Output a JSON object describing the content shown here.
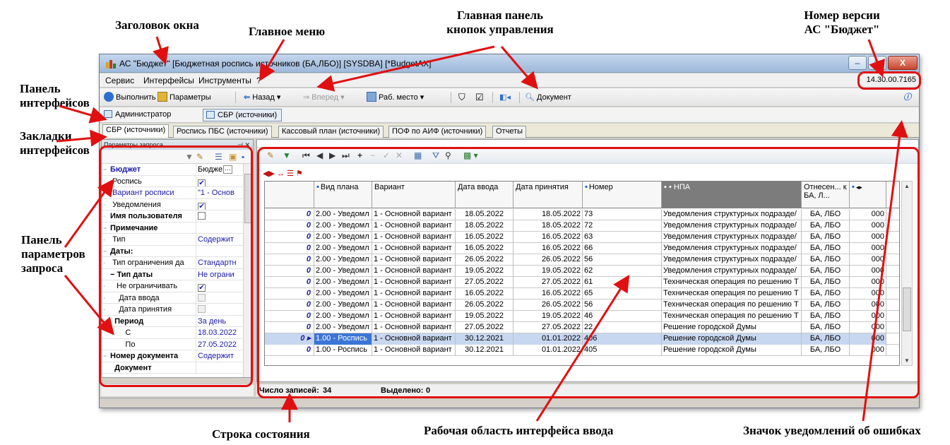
{
  "window": {
    "title": "АС \"Бюджет\" [Бюджетная роспись источников (БА,ЛБО)] [SYSDBA] [*BudgetAX]",
    "controls": [
      "–",
      "□",
      "X"
    ]
  },
  "menu": {
    "items": [
      "Сервис",
      "Интерфейсы",
      "Инструменты",
      "?"
    ],
    "version": "14.30.00.7165"
  },
  "toolbar": {
    "run": "Выполнить",
    "params": "Параметры",
    "back": "Назад",
    "forward": "Вперед",
    "workplace": "Раб. место",
    "document": "Документ"
  },
  "interfaces": {
    "admin": "Администратор",
    "sbr": "СБР (источники)"
  },
  "tabs": [
    "СБР (источники)",
    "Роспись ПБС (источники)",
    "Кассовый план (источники)",
    "ПОФ по АИФ (источники)",
    "Отчеты"
  ],
  "params": {
    "header": "Параметры запроса",
    "rows": [
      {
        "label": "Бюджет",
        "value": "Бюдже"
      },
      {
        "label": "Роспись",
        "value": ""
      },
      {
        "label": "Вариант росписи",
        "value": "\"1 - Основ"
      },
      {
        "label": "Уведомления",
        "value": ""
      },
      {
        "label": "Имя пользователя",
        "value": ""
      },
      {
        "label": "Примечание",
        "value": ""
      },
      {
        "label": "Тип",
        "value": "Содержит"
      },
      {
        "label": "Даты:",
        "value": ""
      },
      {
        "label": "Тип ограничения да",
        "value": "Стандартн"
      },
      {
        "label": "Тип даты",
        "value": "Не ограни"
      },
      {
        "label": "Не ограничивать",
        "value": ""
      },
      {
        "label": "Дата ввода",
        "value": ""
      },
      {
        "label": "Дата принятия",
        "value": ""
      },
      {
        "label": "Период",
        "value": "За день"
      },
      {
        "label": "С",
        "value": "18.03.2022"
      },
      {
        "label": "По",
        "value": "27.05.2022"
      },
      {
        "label": "Номер документа",
        "value": "Содержит"
      },
      {
        "label": "Документ",
        "value": ""
      }
    ]
  },
  "grid": {
    "columns": [
      "Вид плана",
      "Вариант",
      "Дата ввода",
      "Дата принятия",
      "Номер",
      "НПА",
      "Отнесен... к БА, Л...",
      ""
    ],
    "rows": [
      [
        "2.00 - Уведомл",
        "1 - Основной вариант",
        "18.05.2022",
        "18.05.2022",
        "73",
        "Уведомления структурных подразде/",
        "БА, ЛБО",
        "000"
      ],
      [
        "2.00 - Уведомл",
        "1 - Основной вариант",
        "18.05.2022",
        "18.05.2022",
        "72",
        "Уведомления структурных подразде/",
        "БА, ЛБО",
        "000"
      ],
      [
        "2.00 - Уведомл",
        "1 - Основной вариант",
        "16.05.2022",
        "16.05.2022",
        "63",
        "Уведомления структурных подразде/",
        "БА, ЛБО",
        "000"
      ],
      [
        "2.00 - Уведомл",
        "1 - Основной вариант",
        "16.05.2022",
        "16.05.2022",
        "66",
        "Уведомления структурных подразде/",
        "БА, ЛБО",
        "000"
      ],
      [
        "2.00 - Уведомл",
        "1 - Основной вариант",
        "26.05.2022",
        "26.05.2022",
        "56",
        "Уведомления структурных подразде/",
        "БА, ЛБО",
        "000"
      ],
      [
        "2.00 - Уведомл",
        "1 - Основной вариант",
        "19.05.2022",
        "19.05.2022",
        "62",
        "Уведомления структурных подразде/",
        "БА, ЛБО",
        "000"
      ],
      [
        "2.00 - Уведомл",
        "1 - Основной вариант",
        "27.05.2022",
        "27.05.2022",
        "61",
        "Техническая операция по решению Т",
        "БА, ЛБО",
        "000"
      ],
      [
        "2.00 - Уведомл",
        "1 - Основной вариант",
        "16.05.2022",
        "16.05.2022",
        "65",
        "Техническая операция по решению Т",
        "БА, ЛБО",
        "000"
      ],
      [
        "2.00 - Уведомл",
        "1 - Основной вариант",
        "26.05.2022",
        "26.05.2022",
        "56",
        "Техническая операция по решению Т",
        "БА, ЛБО",
        "000"
      ],
      [
        "2.00 - Уведомл",
        "1 - Основной вариант",
        "19.05.2022",
        "19.05.2022",
        "46",
        "Техническая операция по решению Т",
        "БА, ЛБО",
        "000"
      ],
      [
        "2.00 - Уведомл",
        "1 - Основной вариант",
        "27.05.2022",
        "27.05.2022",
        "22",
        "Решение городской Думы",
        "БА, ЛБО",
        "000"
      ],
      [
        "1.00 - Роспись",
        "1 - Основной вариант",
        "30.12.2021",
        "01.01.2022",
        "406",
        "Решение городской Думы",
        "БА, ЛБО",
        "000"
      ],
      [
        "1.00 - Роспись",
        "1 - Основной вариант",
        "30.12.2021",
        "01.01.2022",
        "405",
        "Решение городской Думы",
        "БА, ЛБО",
        "000"
      ]
    ],
    "selected_row": 11
  },
  "status": {
    "records_label": "Число записей:",
    "records_value": "34",
    "selected_label": "Выделено:",
    "selected_value": "0"
  },
  "annotations": {
    "window_title": "Заголовок окна",
    "main_menu": "Главное меню",
    "main_toolbar_1": "Главная панель",
    "main_toolbar_2": "кнопок управления",
    "version_1": "Номер версии",
    "version_2": "АС \"Бюджет\"",
    "interfaces_panel_1": "Панель",
    "interfaces_panel_2": "интерфейсов",
    "interface_tabs_1": "Закладки",
    "interface_tabs_2": "интерфейсов",
    "params_panel_1": "Панель",
    "params_panel_2": "параметров",
    "params_panel_3": "запроса",
    "status_bar": "Строка состояния",
    "work_area": "Рабочая область интерфейса ввода",
    "error_icon": "Значок уведомлений об ошибках"
  }
}
